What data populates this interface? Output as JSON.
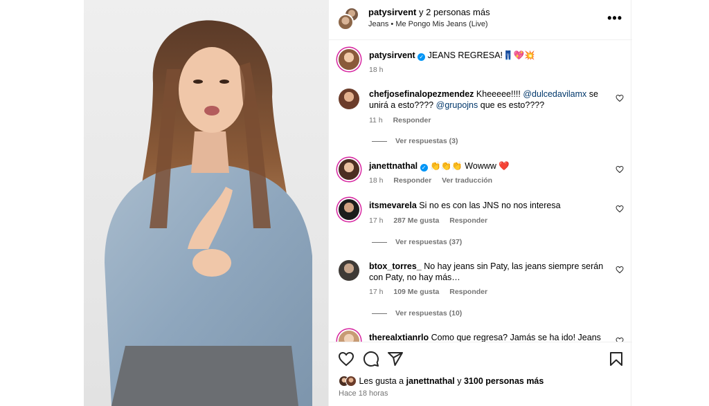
{
  "header": {
    "username": "patysirvent",
    "coauthors": "y 2 personas más",
    "subtitle": "Jeans • Me Pongo Mis Jeans (Live)",
    "more_label": "•••"
  },
  "caption": {
    "username": "patysirvent",
    "verified_mark": "✓",
    "text": "JEANS REGRESA!👖💖💥",
    "time": "18 h"
  },
  "comments": [
    {
      "username": "chefjosefinalopezmendez",
      "text_before": "Kheeeee!!!!",
      "mention1": "@dulcedavilamx",
      "text_mid": "se unirá a esto????",
      "mention2": "@grupojns",
      "text_after": "que es esto????",
      "time": "11 h",
      "reply": "Responder",
      "view_replies": "Ver respuestas (3)"
    },
    {
      "username": "janettnathal",
      "verified_mark": "✓",
      "text": "👏👏👏 Wowww ❤️",
      "time": "18 h",
      "reply": "Responder",
      "translate": "Ver traducción"
    },
    {
      "username": "itsmevarela",
      "text": "Si no es con las JNS no nos interesa",
      "time": "17 h",
      "likes": "287 Me gusta",
      "reply": "Responder",
      "view_replies": "Ver respuestas (37)"
    },
    {
      "username": "btox_torres_",
      "text": "No hay jeans sin Paty, las jeans siempre serán con Paty, no hay más…",
      "time": "17 h",
      "likes": "109 Me gusta",
      "reply": "Responder",
      "view_replies": "Ver respuestas (10)"
    },
    {
      "username": "therealxtianrlo",
      "text": "Como que regresa? Jamás se ha ido! Jeans"
    }
  ],
  "footer": {
    "likes_prefix": "Les gusta a",
    "likes_user": "janettnathal",
    "likes_mid": "y",
    "likes_count": "3100 personas más",
    "time": "Hace 18 horas"
  },
  "icons": {
    "like": "heart-icon",
    "comment": "comment-icon",
    "share": "share-icon",
    "save": "bookmark-icon",
    "more": "more-icon"
  },
  "colors": {
    "link": "#00376b",
    "verified": "#0095f6",
    "secondary_text": "#737373",
    "heart_red": "#e0245e"
  }
}
